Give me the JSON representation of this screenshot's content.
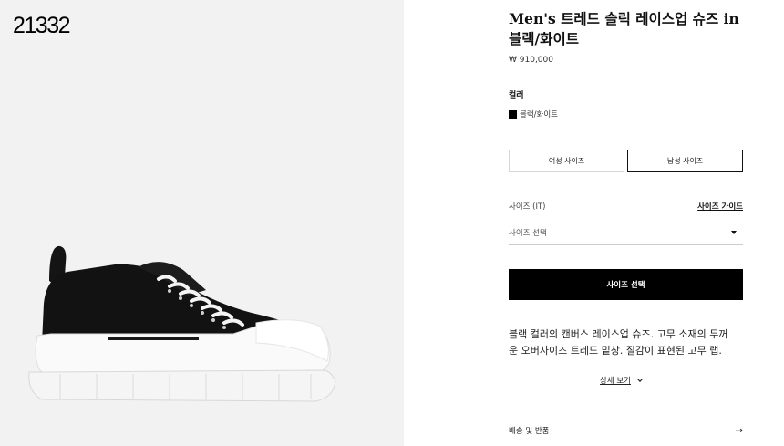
{
  "gallery": {
    "stock_id": "21332",
    "colors": {
      "background": "#f2f2f2",
      "upper": "#111111",
      "sole": "#ffffff"
    }
  },
  "product": {
    "title": "Men's 트레드 슬릭 레이스업 슈즈 in 블랙/화이트",
    "price": "₩ 910,000"
  },
  "color": {
    "label": "컬러",
    "selected": "블랙/화이트",
    "swatch_hex": "#000000"
  },
  "size_tabs": [
    {
      "label": "여성 사이즈",
      "active": false
    },
    {
      "label": "남성 사이즈",
      "active": true
    }
  ],
  "size": {
    "label": "사이즈 (IT)",
    "guide_link": "사이즈 가이드",
    "select_text": "사이즈 선택"
  },
  "cta": {
    "label": "사이즈 선택"
  },
  "description": {
    "line1": "블랙 컬러의 캔버스 레이스업 슈즈. 고무 소재의 두꺼",
    "line2": "운 오버사이즈 트레드 밑창. 질감이 표현된 고무 랩.",
    "more_label": "상세 보기"
  },
  "shipping": {
    "label": "배송 및 반품",
    "arrow": "→"
  }
}
